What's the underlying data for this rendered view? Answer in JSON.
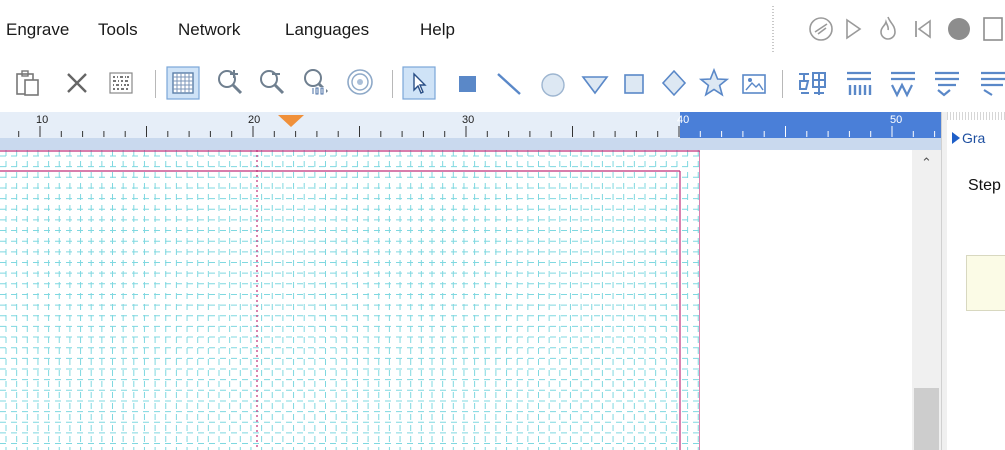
{
  "menu": {
    "engrave": "Engrave",
    "tools": "Tools",
    "network": "Network",
    "languages": "Languages",
    "help": "Help"
  },
  "ruler": {
    "labels": [
      "10",
      "20",
      "30",
      "40",
      "50"
    ]
  },
  "panel": {
    "header": "Gra",
    "step_label": "Step"
  },
  "colors": {
    "accent": "#1e5fc8",
    "grid": "#7fd8e0",
    "boundary": "#c0307a",
    "ruler_highlight": "#4a7fd8",
    "marker": "#f0903a"
  },
  "icons": {
    "run_controls": [
      "engrave-disabled-icon",
      "play-icon",
      "flame-icon",
      "skip-back-icon",
      "stop-icon"
    ],
    "toolbar": [
      "paste-icon",
      "delete-icon",
      "barcode-icon",
      "grid-toggle-icon",
      "zoom-in-icon",
      "zoom-out-icon",
      "zoom-100-icon",
      "zoom-fit-icon",
      "pointer-icon",
      "rectangle-fill-icon",
      "line-icon",
      "circle-icon",
      "triangle-icon",
      "square-icon",
      "diamond-icon",
      "star-icon",
      "image-icon",
      "text-icon",
      "align-top-icon",
      "align-middle-icon",
      "align-bottom-icon"
    ]
  }
}
